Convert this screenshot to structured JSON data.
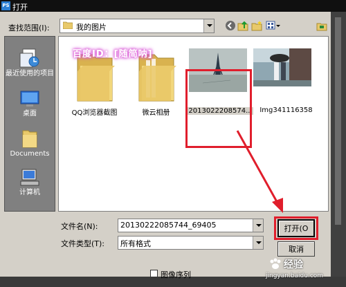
{
  "window": {
    "app_icon": "PS",
    "title": "打开"
  },
  "lookin": {
    "label": "查找范围(I):",
    "value": "我的图片"
  },
  "places": [
    {
      "name": "recent",
      "label": "最近使用的项目",
      "icon": "recent-docs-icon"
    },
    {
      "name": "desktop",
      "label": "桌面",
      "icon": "desktop-icon"
    },
    {
      "name": "documents",
      "label": "Documents",
      "icon": "folder-icon"
    },
    {
      "name": "computer",
      "label": "计算机",
      "icon": "computer-icon"
    }
  ],
  "files": [
    {
      "label": "QQ浏览器截图",
      "kind": "folder"
    },
    {
      "label": "微云相册",
      "kind": "folder"
    },
    {
      "label": "2013022208574...",
      "kind": "image"
    },
    {
      "label": "Img341116358",
      "kind": "image"
    }
  ],
  "watermark": "百度ID：[随简呐]",
  "filename": {
    "label": "文件名(N):",
    "value": "20130222085744_69405"
  },
  "filetype": {
    "label": "文件类型(T):",
    "value": "所有格式"
  },
  "buttons": {
    "open": "打开(O",
    "cancel": "取消"
  },
  "sequence": {
    "label": "图像序列",
    "checked": false
  },
  "baidu_jingyan": {
    "title": "经验",
    "url": "jingyan.baidu.com"
  },
  "colors": {
    "highlight": "#e01e2c",
    "dialog": "#d4d0c8",
    "places_bg": "#808080"
  }
}
